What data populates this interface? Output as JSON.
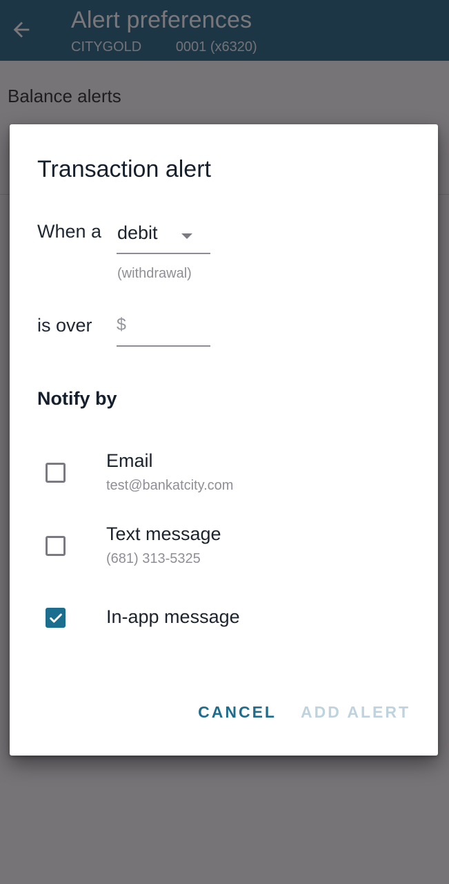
{
  "app_bar": {
    "title": "Alert preferences",
    "account_name": "CITYGOLD",
    "account_number": "0001 (x6320)",
    "back_icon": "arrow-left-icon"
  },
  "page": {
    "section_title": "Balance alerts"
  },
  "dialog": {
    "title": "Transaction alert",
    "when_label": "When a",
    "transaction_type": {
      "selected": "debit",
      "hint": "(withdrawal)",
      "icon": "caret-down-icon"
    },
    "amount": {
      "label": "is over",
      "prefix": "$",
      "value": "",
      "placeholder": ""
    },
    "notify_title": "Notify by",
    "options": [
      {
        "label": "Email",
        "detail": "test@bankatcity.com",
        "checked": false
      },
      {
        "label": "Text message",
        "detail": "(681) 313-5325",
        "checked": false
      },
      {
        "label": "In-app message",
        "detail": "",
        "checked": true
      }
    ],
    "actions": {
      "cancel": "CANCEL",
      "add": "ADD ALERT",
      "add_enabled": false
    }
  },
  "colors": {
    "app_bar": "#0b5573",
    "accent": "#1b6e8e",
    "disabled_button": "#bfd3de",
    "scrim": "rgba(40,36,42,0.62)"
  }
}
